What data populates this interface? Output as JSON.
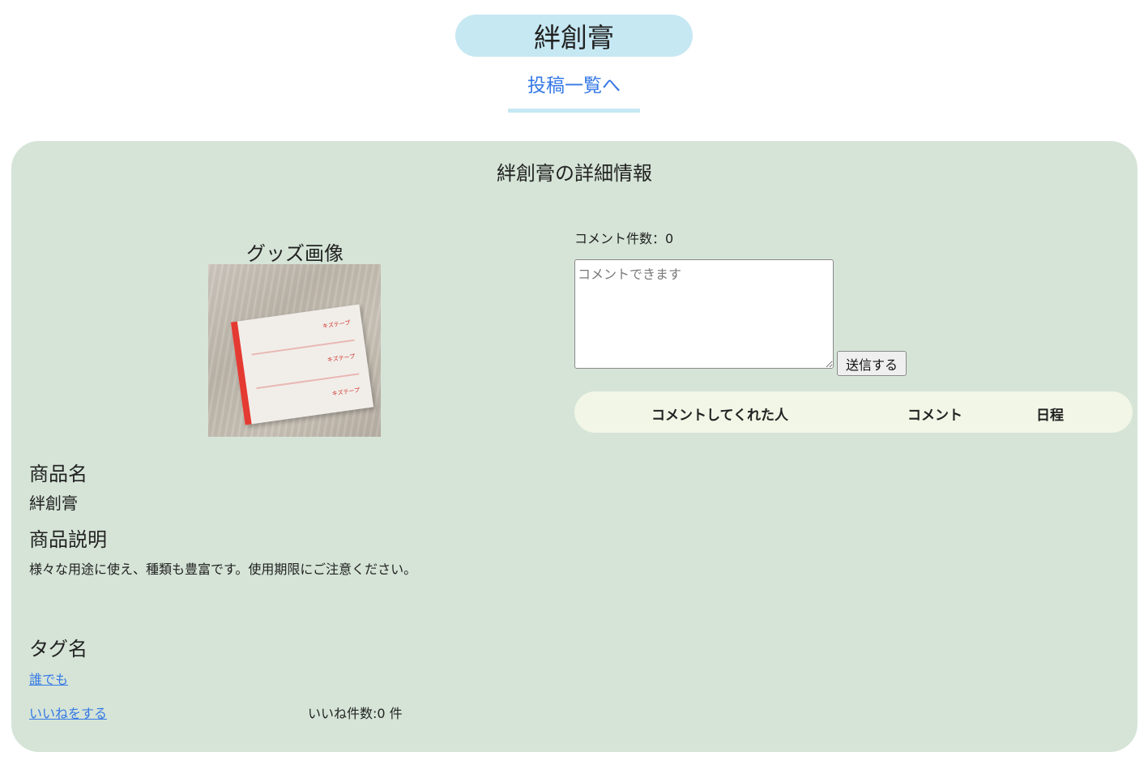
{
  "header": {
    "title": "絆創膏",
    "back_link": "投稿一覧へ"
  },
  "detail": {
    "section_title": "絆創膏の詳細情報",
    "image_heading": "グッズ画像",
    "image_alt_text": [
      "キズテープ",
      "キズテープ",
      "キズテープ"
    ],
    "product_name_heading": "商品名",
    "product_name": "絆創膏",
    "description_heading": "商品説明",
    "description": "様々な用途に使え、種類も豊富です。使用期限にご注意ください。",
    "tag_heading": "タグ名",
    "tag": "誰でも",
    "like_link": "いいねをする",
    "like_count": "いいね件数:0 件"
  },
  "comments": {
    "count_label": "コメント件数：0",
    "input_placeholder": "コメントできます",
    "input_value": "",
    "send_label": "送信する",
    "columns": [
      "コメントしてくれた人",
      "コメント",
      "日程"
    ],
    "rows": []
  }
}
